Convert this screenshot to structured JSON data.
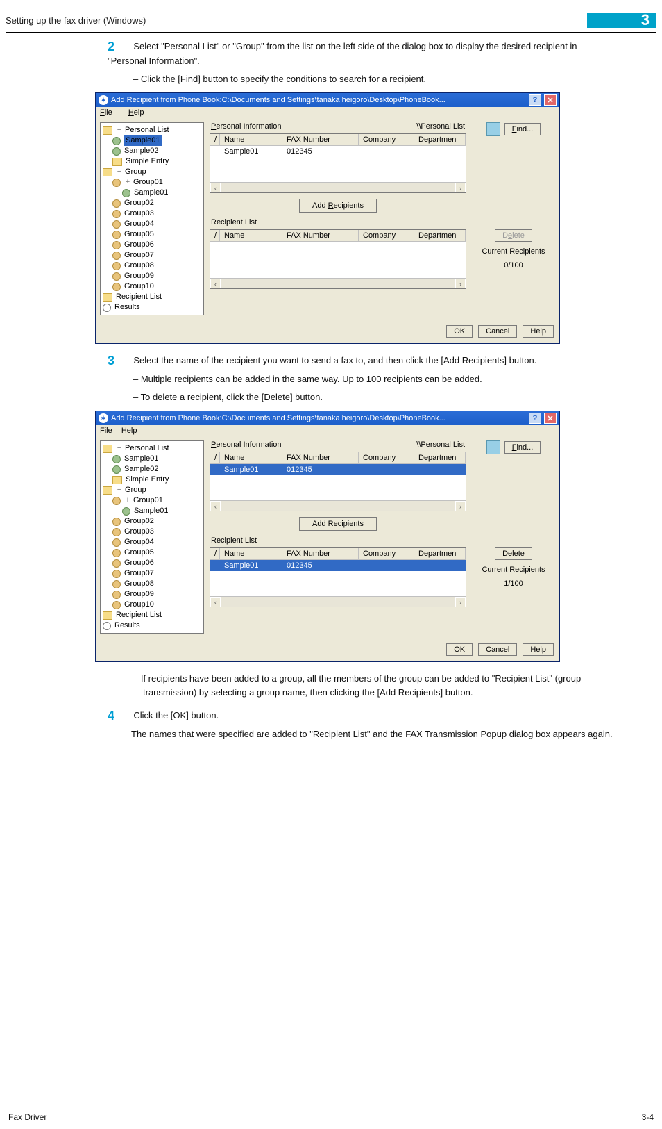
{
  "header": {
    "title": "Setting up the fax driver (Windows)",
    "chapter_number": "3"
  },
  "steps": {
    "s2": {
      "num": "2",
      "text": "Select \"Personal List\" or \"Group\" from the list on the left side of the dialog box to display the desired recipient in \"Personal Information\"."
    },
    "s2b1": "Click the [Find] button to specify the conditions to search for a recipient.",
    "s3": {
      "num": "3",
      "text": "Select the name of the recipient you want to send a fax to, and then click the [Add Recipients] button."
    },
    "s3b1": "Multiple recipients can be added in the same way. Up to 100 recipients can be added.",
    "s3b2": "To delete a recipient, click the [Delete] button.",
    "s3b3": "If recipients have been added to a group, all the members of the group can be added to \"Recipient List\" (group transmission) by selecting a group name, then clicking the [Add Recipients] button.",
    "s4": {
      "num": "4",
      "text": "Click the [OK] button."
    },
    "s4p": "The names that were specified are added to \"Recipient List\" and the FAX Transmission Popup dialog box appears again."
  },
  "dialog": {
    "title": "Add Recipient from Phone Book:C:\\Documents and Settings\\tanaka heigoro\\Desktop\\PhoneBook...",
    "menu": {
      "file": "File",
      "help": "Help",
      "file_u": "F",
      "help_u": "H"
    },
    "tree": {
      "personal_list": "Personal List",
      "sample01": "Sample01",
      "sample02": "Sample02",
      "simple_entry": "Simple Entry",
      "group": "Group",
      "groups": [
        "Group01",
        "Group02",
        "Group03",
        "Group04",
        "Group05",
        "Group06",
        "Group07",
        "Group08",
        "Group09",
        "Group10"
      ],
      "recipient_list": "Recipient List",
      "results": "Results"
    },
    "sect": {
      "personal_info": "Personal Information",
      "path": "\\\\Personal List",
      "cols": {
        "slash": "/",
        "name": "Name",
        "fax": "FAX Number",
        "company": "Company",
        "dept": "Departmen"
      },
      "row_name": "Sample01",
      "row_fax": "012345",
      "add_recipients": "Add Recipients",
      "recipient_list": "Recipient List"
    },
    "buttons": {
      "find": "Find...",
      "delete": "Delete",
      "current": "Current Recipients",
      "count0": "0/100",
      "count1": "1/100",
      "ok": "OK",
      "cancel": "Cancel",
      "help": "Help"
    }
  },
  "footer": {
    "left": "Fax Driver",
    "right": "3-4"
  }
}
